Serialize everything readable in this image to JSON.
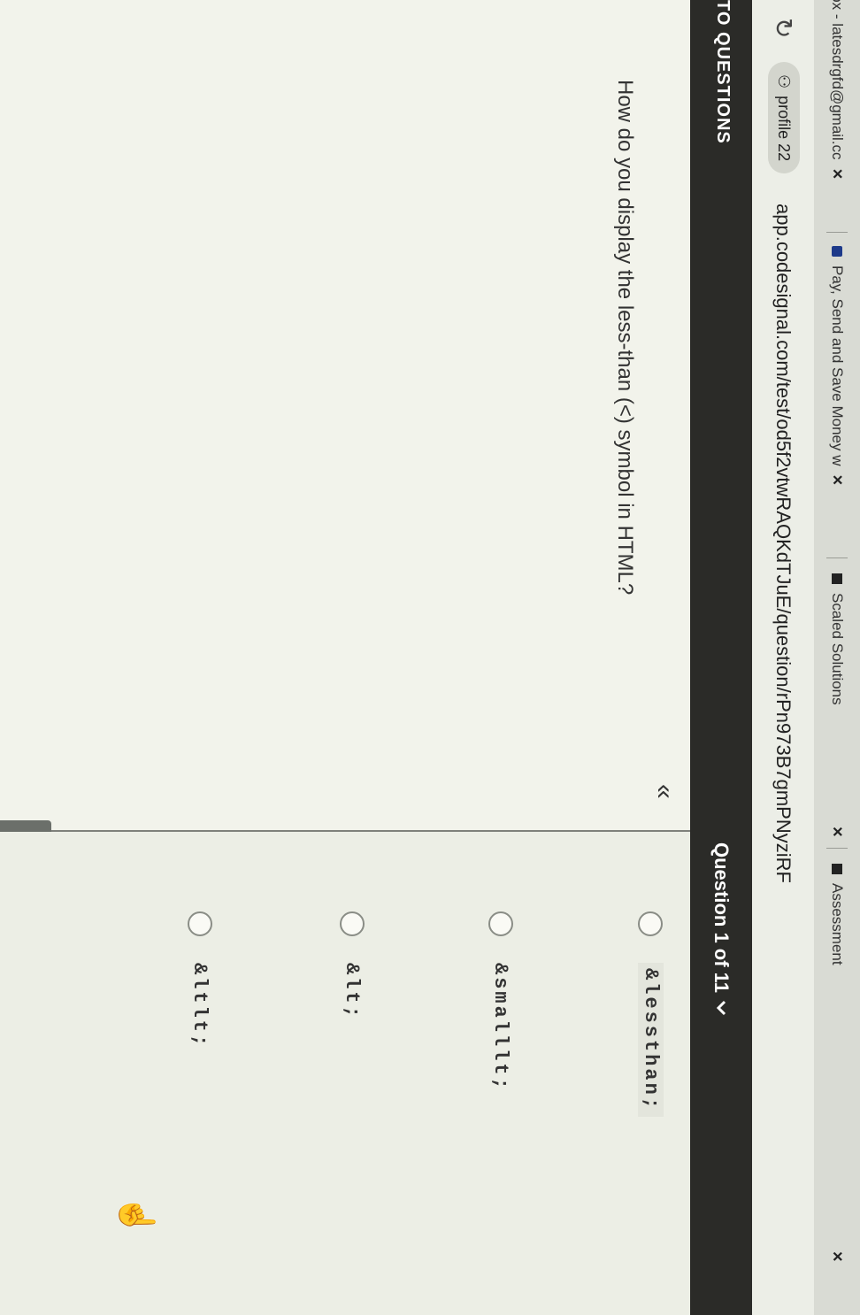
{
  "browser": {
    "tabs": [
      {
        "title": "lbox - latesdrgfd@gmail.cc",
        "close": "×"
      },
      {
        "title": "Pay, Send and Save Money w",
        "close": "×"
      },
      {
        "title": "Scaled Solutions",
        "close": "×"
      },
      {
        "title": "Assessment",
        "close": "×"
      }
    ],
    "profile_label": "profile 22",
    "url": "app.codesignal.com/test/od5f2vtwRAQKdTJuE/question/rPn973B7gmPNyziRF"
  },
  "app": {
    "back_label": "TO QUESTIONS",
    "question_nav": "Question 1 of 11",
    "collapse_glyph": "«"
  },
  "question": {
    "text": "How do you display the less-than (<) symbol in HTML?",
    "answers": [
      {
        "label": "&lessthan;"
      },
      {
        "label": "&smalllt;"
      },
      {
        "label": "&lt;"
      },
      {
        "label": "&ltlt;"
      }
    ]
  },
  "colors": {
    "header_bg": "#2b2b28",
    "content_bg": "#f1f2ea",
    "paypal_favicon": "#1d3a8a"
  }
}
